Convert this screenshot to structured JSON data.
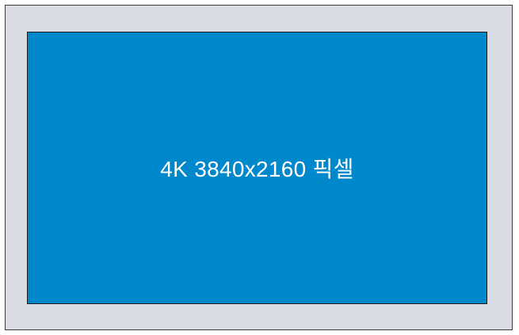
{
  "colors": {
    "bezel": "#d9dce2",
    "screen": "#0088cc",
    "text": "#ffffff"
  },
  "screen": {
    "label": "4K 3840x2160 픽셀"
  }
}
